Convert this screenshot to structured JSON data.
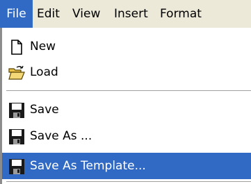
{
  "menubar": {
    "items": [
      "File",
      "Edit",
      "View",
      "Insert",
      "Format"
    ]
  },
  "file_menu": {
    "items": [
      {
        "label": "New",
        "icon": "new-document-icon"
      },
      {
        "label": "Load",
        "icon": "open-folder-icon"
      },
      {
        "label": "Save",
        "icon": "floppy-disk-icon"
      },
      {
        "label": "Save As ...",
        "icon": "floppy-disk-icon"
      },
      {
        "label": "Save As Template...",
        "icon": "floppy-disk-icon",
        "highlighted": true
      }
    ]
  },
  "colors": {
    "highlight": "#316ac5",
    "menubar_bg": "#ece9d8"
  }
}
